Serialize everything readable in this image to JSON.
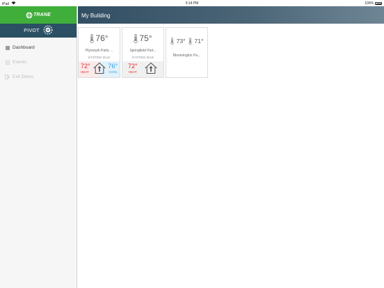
{
  "statusbar": {
    "device": "iPad",
    "time": "5:14 PM",
    "battery": "100%"
  },
  "colors": {
    "brand_green": "#3fae3a",
    "pivot_navy": "#2b4f63",
    "heat": "#e02a2a",
    "cool": "#2aa0e0"
  },
  "sidebar": {
    "brand": "TRANE",
    "pivot_label": "PIVOT",
    "items": [
      {
        "label": "Dashboard",
        "icon": "dashboard-icon",
        "active": true
      },
      {
        "label": "Events",
        "icon": "events-icon",
        "active": false
      },
      {
        "label": "Exit Demo",
        "icon": "exit-icon",
        "active": false
      }
    ]
  },
  "header": {
    "title": "My Building"
  },
  "cards": [
    {
      "name": "Plymouth Parts ...",
      "temp": "76°",
      "status": "SYSTEM IDLE",
      "heat_set": "72°",
      "heat_label": "HEAT",
      "cool_set": "76°",
      "cool_label": "COOL"
    },
    {
      "name": "Springfield Part...",
      "temp": "75°",
      "status": "SYSTEM IDLE",
      "heat_set": "72°",
      "heat_label": "HEAT"
    },
    {
      "name": "Bloomington Pa...",
      "temp_a": "73°",
      "temp_b": "71°"
    }
  ]
}
